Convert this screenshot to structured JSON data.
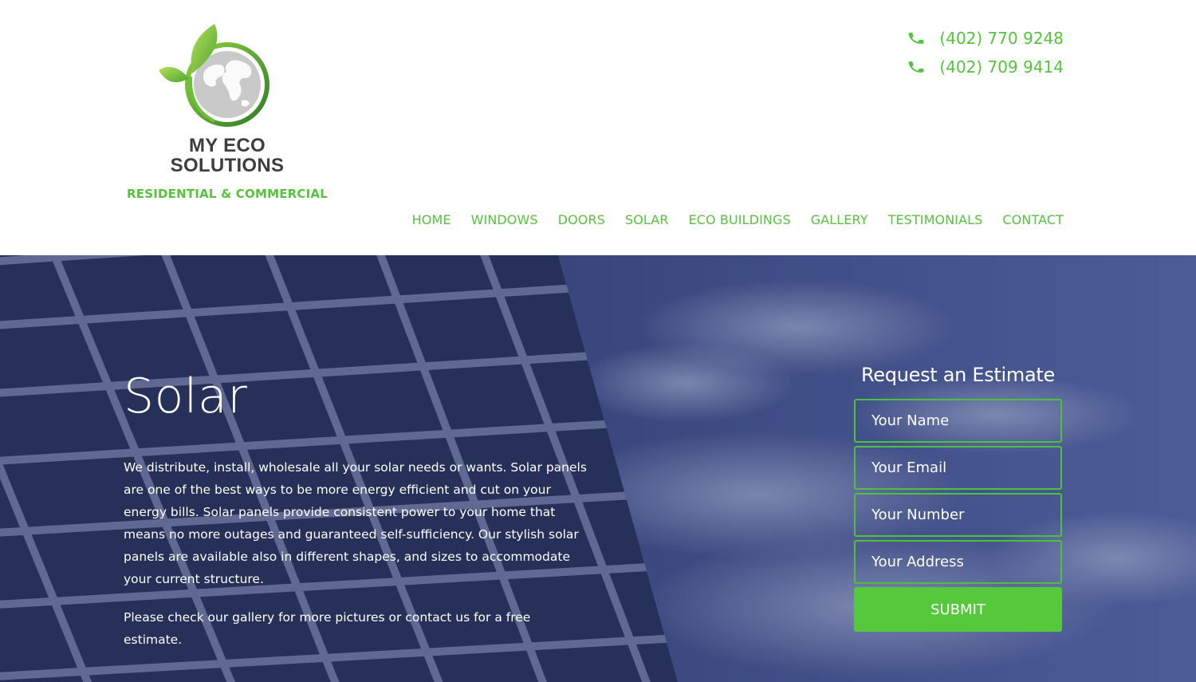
{
  "brand": {
    "name_line1": "MY ECO",
    "name_line2": "SOLUTIONS",
    "tagline": "RESIDENTIAL & COMMERCIAL",
    "accent_color": "#55c33c"
  },
  "contact": {
    "phones": [
      "(402) 770 9248",
      "(402) 709 9414"
    ]
  },
  "nav": {
    "items": [
      "HOME",
      "WINDOWS",
      "DOORS",
      "SOLAR",
      "ECO BUILDINGS",
      "GALLERY",
      "TESTIMONIALS",
      "CONTACT"
    ]
  },
  "hero": {
    "title": "Solar",
    "paragraph1": "We distribute, install, wholesale all your solar needs or wants. Solar panels are one of the best ways to be more energy efficient and cut on your energy bills. Solar panels provide consistent power to your home that means no more outages and guaranteed self-sufficiency. Our stylish solar panels are available also in different shapes, and sizes to accommodate your current structure.",
    "paragraph2": "Please check our gallery for more pictures or contact us for a free estimate."
  },
  "estimate_form": {
    "title": "Request an Estimate",
    "name_placeholder": "Your Name",
    "email_placeholder": "Your Email",
    "number_placeholder": "Your Number",
    "address_placeholder": "Your Address",
    "submit_label": "SUBMIT"
  }
}
